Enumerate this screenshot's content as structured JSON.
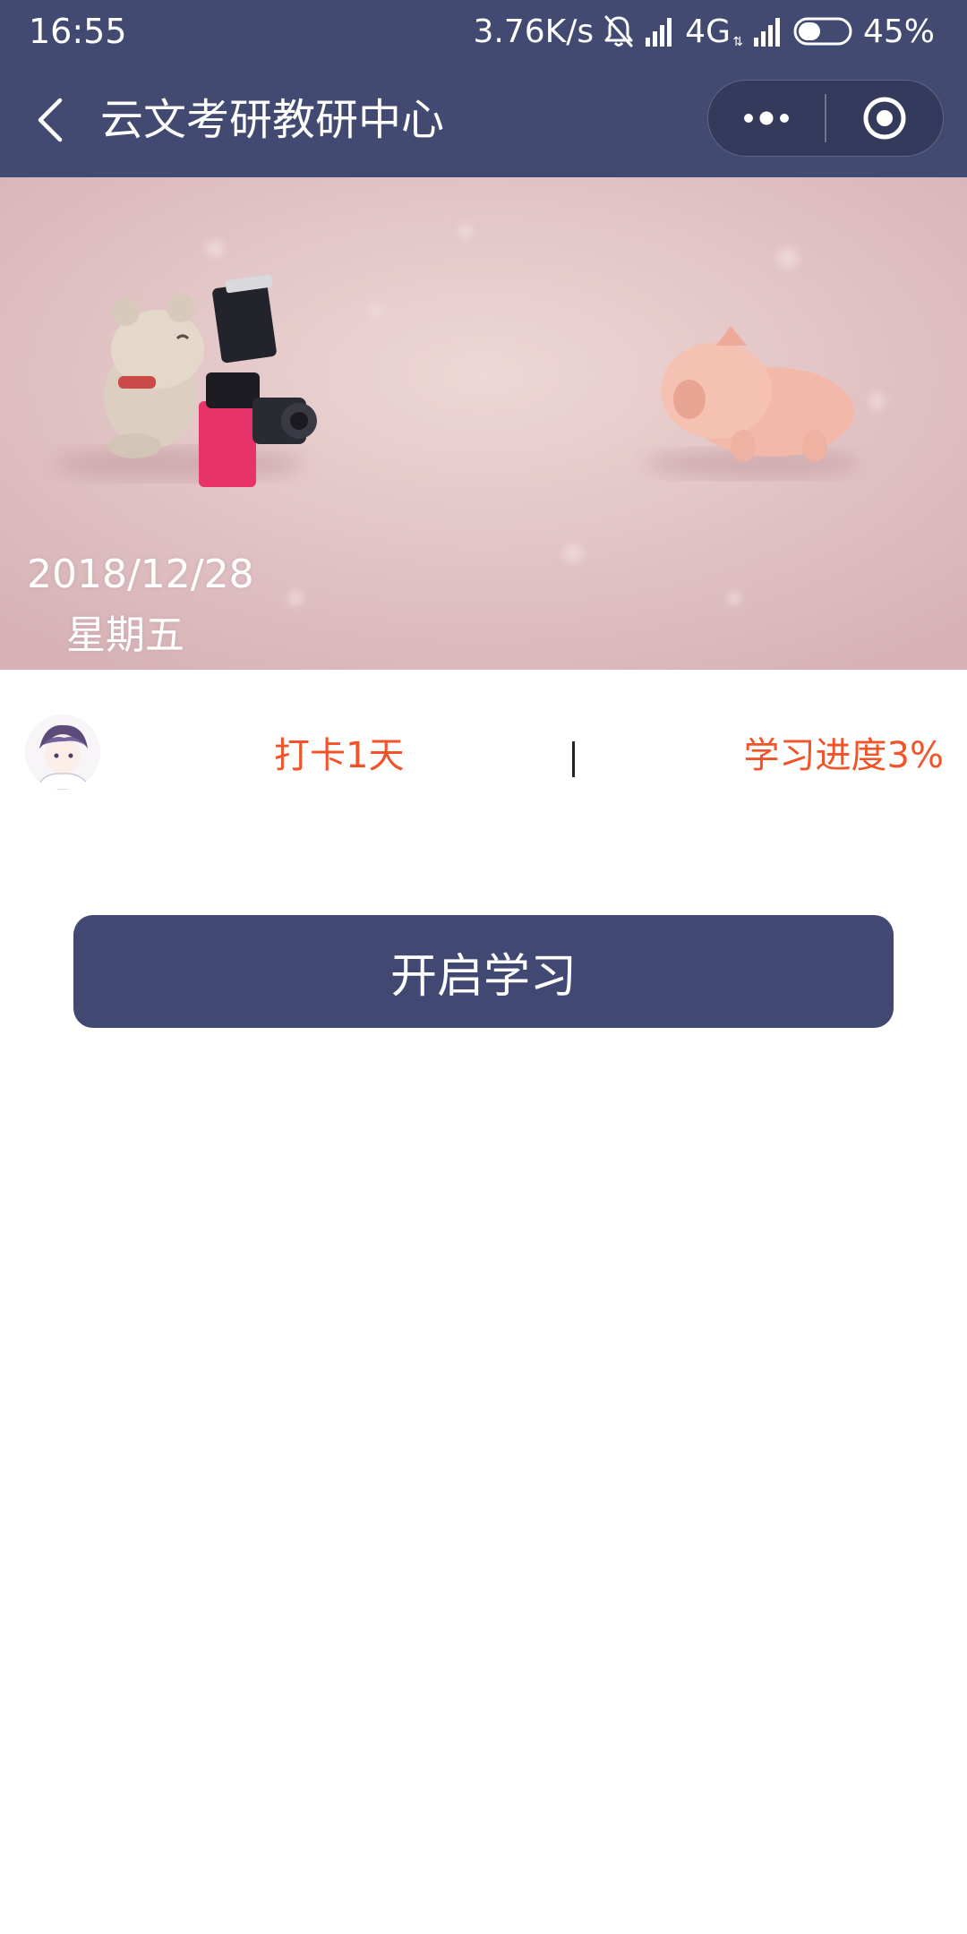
{
  "status_bar": {
    "time": "16:55",
    "net_speed": "3.76K/s",
    "network_type": "4G",
    "network_arrows": "⇅",
    "battery_percent": "45%",
    "battery_level": 0.45
  },
  "nav": {
    "title": "云文考研教研中心"
  },
  "banner": {
    "date": "2018/12/28",
    "weekday": "星期五"
  },
  "stats": {
    "checkin": "打卡1天",
    "progress": "学习进度3%"
  },
  "start_button": {
    "label": "开启学习"
  },
  "colors": {
    "header_bg": "#424a72",
    "accent_text": "#f1542b",
    "button_bg": "#414872"
  }
}
